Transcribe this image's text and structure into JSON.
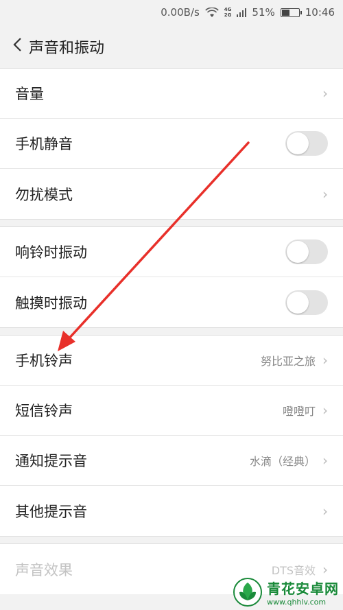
{
  "status": {
    "speed": "0.00B/s",
    "net_top": "4G",
    "net_bottom": "2G",
    "battery_text": "51%",
    "battery_level": 0.51,
    "time": "10:46"
  },
  "header": {
    "back_icon": "chevron-left-icon",
    "title": "声音和振动"
  },
  "group1": [
    {
      "label": "音量",
      "type": "chevron"
    },
    {
      "label": "手机静音",
      "type": "toggle",
      "on": false
    },
    {
      "label": "勿扰模式",
      "type": "chevron"
    }
  ],
  "group2": [
    {
      "label": "响铃时振动",
      "type": "toggle",
      "on": false
    },
    {
      "label": "触摸时振动",
      "type": "toggle",
      "on": false
    }
  ],
  "group3": [
    {
      "label": "手机铃声",
      "value": "努比亚之旅"
    },
    {
      "label": "短信铃声",
      "value": "噔噔叮"
    },
    {
      "label": "通知提示音",
      "value": "水滴（经典）"
    },
    {
      "label": "其他提示音",
      "value": ""
    }
  ],
  "group4": [
    {
      "label": "声音效果",
      "value": "DTS音效",
      "disabled": true
    }
  ],
  "chevron": "›",
  "watermark": {
    "title": "青花安卓网",
    "url": "www.qhhlv.com"
  },
  "colors": {
    "arrow": "#e8302a",
    "watermark": "#1a8a3a"
  }
}
